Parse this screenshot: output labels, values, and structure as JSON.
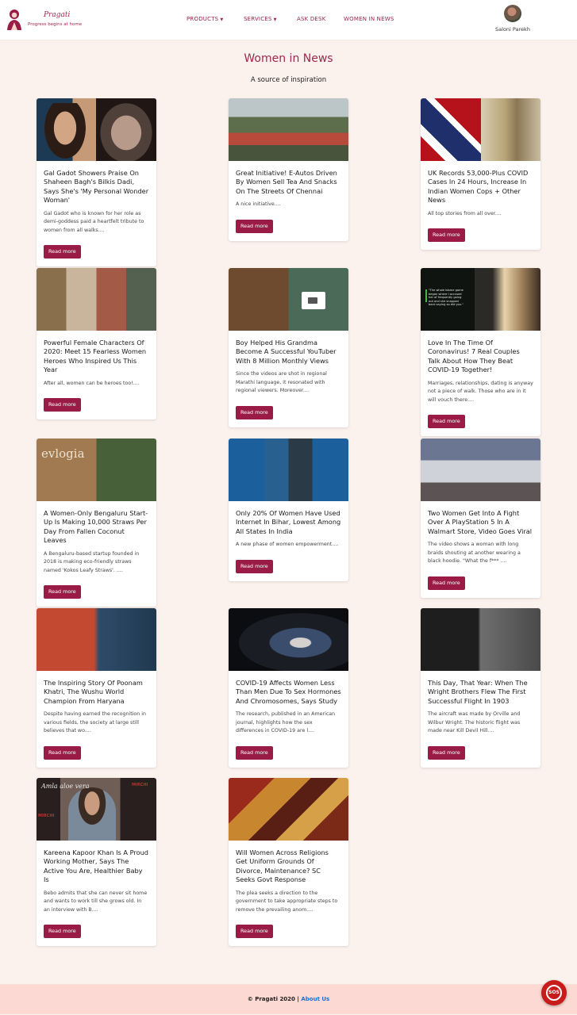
{
  "header": {
    "logo_title": "Pragati",
    "logo_tagline": "Progress begins at home",
    "menu": [
      {
        "label": "PRODUCTS",
        "dropdown": true
      },
      {
        "label": "SERVICES",
        "dropdown": true
      },
      {
        "label": "ASK DESK",
        "dropdown": false
      },
      {
        "label": "WOMEN IN NEWS",
        "dropdown": false
      }
    ],
    "user_name": "Saloni Parekh"
  },
  "page": {
    "title": "Women in News",
    "subtitle": "A source of inspiration"
  },
  "button_label": "Read more",
  "articles": [
    {
      "title": "Gal Gadot Showers Praise On Shaheen Bagh's Bilkis Dadi, Says She's 'My Personal Wonder Woman'",
      "text": "Gal Gadot who is known for her role as demi-goddess paid a heartfelt tribute to women from all walks...."
    },
    {
      "title": "Great Initiative! E-Autos Driven By Women Sell Tea And Snacks On The Streets Of Chennai",
      "text": "A nice initiative...."
    },
    {
      "title": "UK Records 53,000-Plus COVID Cases In 24 Hours, Increase In Indian Women Cops + Other News",
      "text": "All top stories from all over...."
    },
    {
      "title": "Powerful Female Characters Of 2020: Meet 15 Fearless Women Heroes Who Inspired Us This Year",
      "text": "After all, women can be heroes too!...."
    },
    {
      "title": "Boy Helped His Grandma Become A Successful YouTuber With 8 Million Monthly Views",
      "text": "Since the videos are shot in regional Marathi language, it resonated with regional viewers. Moreover...."
    },
    {
      "title": "Love In The Time Of Coronavirus! 7 Real Couples Talk About How They Beat COVID-19 Together!",
      "text": "Marriages, relationships, dating is anyway not a piece of walk. Those who are in it will vouch there...."
    },
    {
      "title": "A Women-Only Bengaluru Start-Up Is Making 10,000 Straws Per Day From Fallen Coconut Leaves",
      "text": "A Bengaluru-based startup founded in 2018 is making eco-friendly straws named 'Kokos Leafy Straws'. ...."
    },
    {
      "title": "Only 20% Of Women Have Used Internet In Bihar, Lowest Among All States In India",
      "text": "A new phase of women empowerment...."
    },
    {
      "title": "Two Women Get Into A Fight Over A PlayStation 5 In A Walmart Store, Video Goes Viral",
      "text": "The video shows a woman with long braids shouting at another wearing a black hoodie. \"What the f*** ...."
    },
    {
      "title": "The Inspiring Story Of Poonam Khatri, The Wushu World Champion From Haryana",
      "text": "Despite having earned the recognition in various fields, the society at large still believes that wo...."
    },
    {
      "title": "COVID-19 Affects Women Less Than Men Due To Sex Hormones And Chromosomes, Says Study",
      "text": "The research, published in an American journal, highlights how the sex differences in COVID-19 are l...."
    },
    {
      "title": "This Day, That Year: When The Wright Brothers Flew The First Successful Flight In 1903",
      "text": "The aircraft was made by Orville and Wilbur Wright. The historic flight was made near Kill Devil Hill...."
    },
    {
      "title": "Kareena Kapoor Khan Is A Proud Working Mother, Says The Active You Are, Healthier Baby Is",
      "text": "Bebo admits that she can never sit home and wants to work till she grows old. In an interview with B...."
    },
    {
      "title": "Will Women Across Religions Get Uniform Grounds Of Divorce, Maintenance? SC Seeks Govt Response",
      "text": "The plea seeks a direction to the government to take appropriate steps to remove the prevailing anom...."
    }
  ],
  "thumb_text": {
    "evlogia": "evlogia",
    "quote": "\"The whole blame game began where I accused her of frequently going out and she snapped back saying so did you.\"",
    "amla": "Amla aloe vera",
    "mirchi": "MIRCHI"
  },
  "footer": {
    "copyright": "© Pragati 2020 | ",
    "about_link": "About Us"
  },
  "sos_label": "SOS",
  "colors": {
    "accent": "#9b1b47",
    "page_bg": "#fbf1ed",
    "footer_bg": "#fcd9d2",
    "link": "#1a6fd6",
    "sos": "#c81b1b"
  }
}
